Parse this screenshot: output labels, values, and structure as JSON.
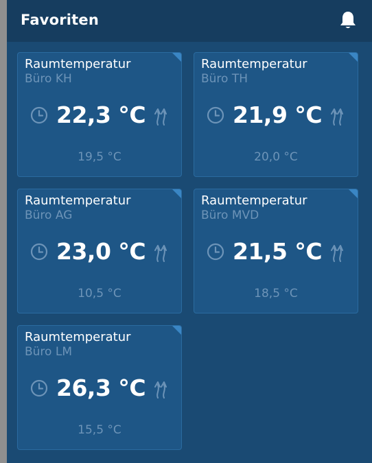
{
  "header": {
    "title": "Favoriten",
    "notification_icon": "bell-icon"
  },
  "tiles": [
    {
      "title": "Raumtemperatur",
      "room": "Büro KH",
      "temperature": "22,3 °C",
      "setpoint": "19,5 °C"
    },
    {
      "title": "Raumtemperatur",
      "room": "Büro TH",
      "temperature": "21,9 °C",
      "setpoint": "20,0 °C"
    },
    {
      "title": "Raumtemperatur",
      "room": "Büro AG",
      "temperature": "23,0 °C",
      "setpoint": "10,5 °C"
    },
    {
      "title": "Raumtemperatur",
      "room": "Büro MVD",
      "temperature": "21,5 °C",
      "setpoint": "18,5 °C"
    },
    {
      "title": "Raumtemperatur",
      "room": "Büro LM",
      "temperature": "26,3 °C",
      "setpoint": "15,5 °C"
    }
  ],
  "colors": {
    "header_bg": "#163d5f",
    "panel_bg": "#1a4a73",
    "tile_bg": "#1e5686",
    "accent": "#3a86c4",
    "muted_text": "#6d94b8"
  }
}
